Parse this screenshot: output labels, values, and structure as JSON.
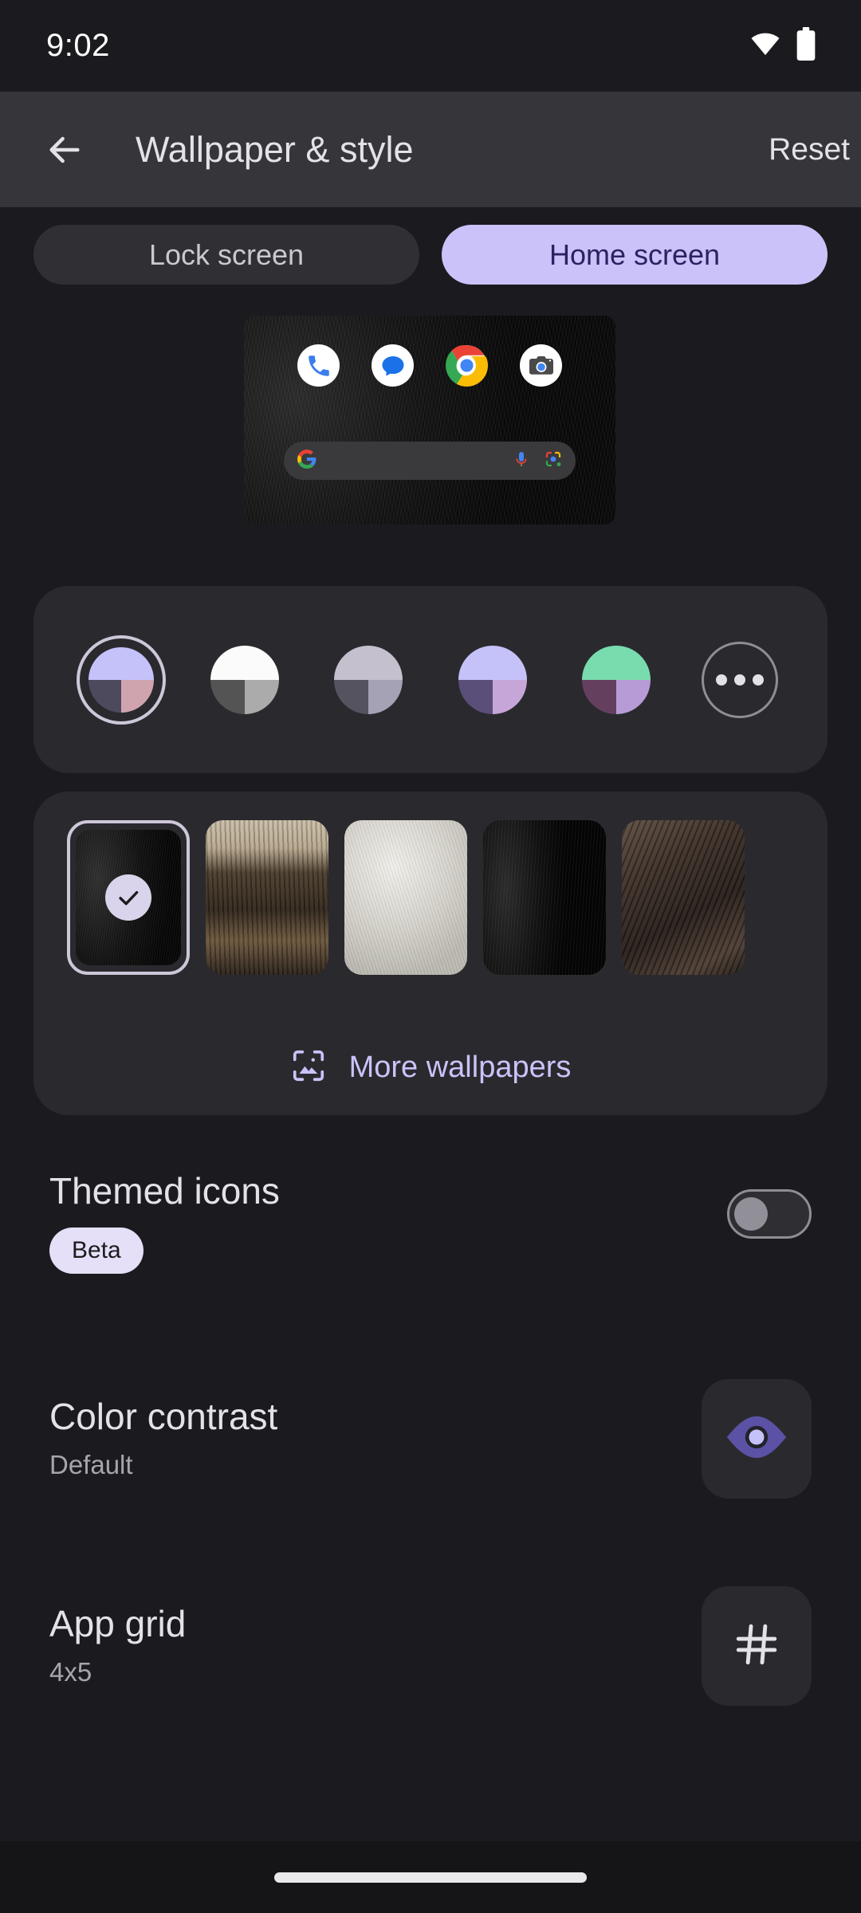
{
  "status_bar": {
    "time": "9:02",
    "icons": [
      "wifi-icon",
      "battery-icon"
    ]
  },
  "app_bar": {
    "back_icon": "back-arrow-icon",
    "title": "Wallpaper & style",
    "reset_label": "Reset"
  },
  "tabs": [
    {
      "label": "Lock screen",
      "selected": false
    },
    {
      "label": "Home screen",
      "selected": true
    }
  ],
  "preview": {
    "name": "home-screen-preview",
    "app_icons": [
      "phone-icon",
      "messages-icon",
      "chrome-icon",
      "camera-icon"
    ],
    "search_bar": {
      "leading_icon": "google-g-icon",
      "mic_icon": "microphone-icon",
      "lens_icon": "google-lens-icon"
    }
  },
  "colors": {
    "swatches": [
      {
        "name": "color-swatch-1",
        "selected": true,
        "top": "#C5C2FA",
        "bottom_left": "#4C4A5C",
        "bottom_right": "#CFA4AE"
      },
      {
        "name": "color-swatch-2",
        "selected": false,
        "top": "#FBFBFB",
        "bottom_left": "#545454",
        "bottom_right": "#ABABAB"
      },
      {
        "name": "color-swatch-3",
        "selected": false,
        "top": "#C5C0CE",
        "bottom_left": "#55535F",
        "bottom_right": "#A5A2B6"
      },
      {
        "name": "color-swatch-4",
        "selected": false,
        "top": "#C5C2FA",
        "bottom_left": "#594F78",
        "bottom_right": "#C6A6D8"
      },
      {
        "name": "color-swatch-5",
        "selected": false,
        "top": "#79DCAE",
        "bottom_left": "#64405E",
        "bottom_right": "#B69BD6"
      }
    ],
    "more_button": {
      "name": "more-colors-button",
      "icon": "ellipsis-icon"
    }
  },
  "wallpapers": {
    "thumbnails": [
      {
        "name": "wallpaper-thumb-1",
        "selected": true,
        "description": "black feather"
      },
      {
        "name": "wallpaper-thumb-2",
        "selected": false,
        "description": "tan brown feather"
      },
      {
        "name": "wallpaper-thumb-3",
        "selected": false,
        "description": "white feather"
      },
      {
        "name": "wallpaper-thumb-4",
        "selected": false,
        "description": "dark black feather"
      },
      {
        "name": "wallpaper-thumb-5",
        "selected": false,
        "description": "brown feather"
      }
    ],
    "check_icon": "check-icon",
    "more_wallpapers": {
      "icon": "image-icon",
      "label": "More wallpapers"
    }
  },
  "settings": {
    "themed_icons": {
      "title": "Themed icons",
      "badge": "Beta",
      "toggle_on": false
    },
    "color_contrast": {
      "title": "Color contrast",
      "subtitle": "Default",
      "icon": "eye-icon"
    },
    "app_grid": {
      "title": "App grid",
      "subtitle": "4x5",
      "icon": "grid-icon"
    }
  },
  "nav_bar": {
    "home_handle": "gesture-home-handle"
  },
  "theme": {
    "page_bg": "#1B1B1F",
    "card_bg": "#2A2A2E",
    "accent": "#CCC2FA",
    "on_surface": "#E4E2E6",
    "on_surface_variant": "#A7A5AB"
  }
}
